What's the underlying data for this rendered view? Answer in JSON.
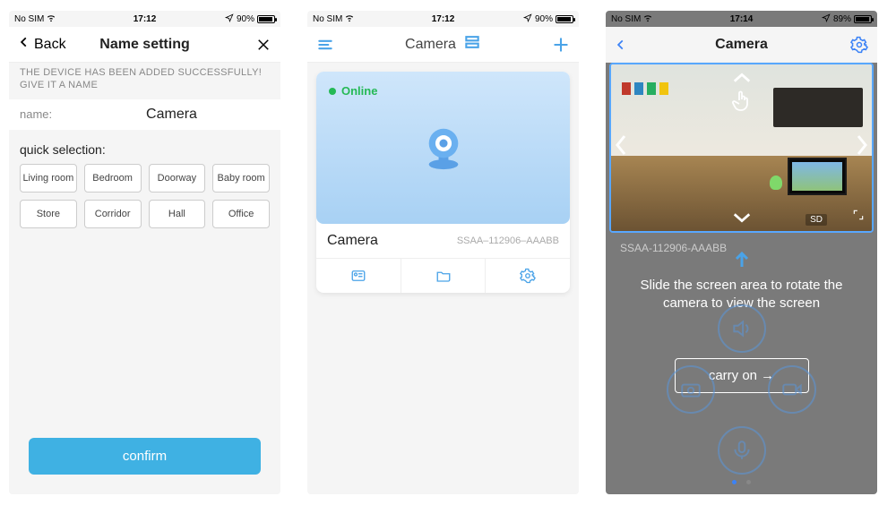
{
  "status": {
    "carrier": "No SIM",
    "time1": "17:12",
    "time2": "17:12",
    "time3": "17:14",
    "battery1": "90%",
    "battery2": "90%",
    "battery3": "89%"
  },
  "screen1": {
    "back_label": "Back",
    "title": "Name setting",
    "added_msg": "THE DEVICE HAS BEEN ADDED SUCCESSFULLY! GIVE IT A NAME",
    "name_label": "name:",
    "name_value": "Camera",
    "quick_label": "quick selection:",
    "chips": [
      "Living room",
      "Bedroom",
      "Doorway",
      "Baby room",
      "Store",
      "Corridor",
      "Hall",
      "Office"
    ],
    "confirm": "confirm"
  },
  "screen2": {
    "title": "Camera",
    "online": "Online",
    "device_name": "Camera",
    "serial": "SSAA–112906–AAABB"
  },
  "screen3": {
    "title": "Camera",
    "serial": "SSAA-112906-AAABB",
    "hint": "Slide the screen area to rotate the camera to view the screen",
    "carry_on": "carry on →",
    "sd": "SD"
  }
}
